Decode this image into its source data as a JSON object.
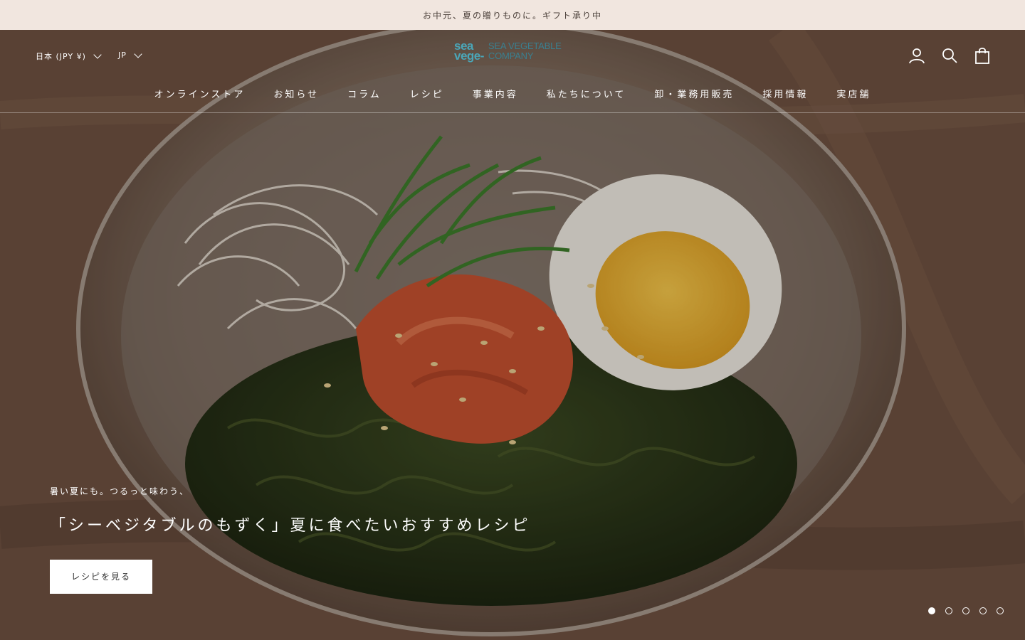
{
  "announcement": {
    "text": "お中元、夏の贈りものに。ギフト承り中"
  },
  "header": {
    "currency_label": "日本 (JPY ¥)",
    "language_label": "JP",
    "logo": {
      "mark_line1": "sea",
      "mark_line2": "vege-",
      "word_line1": "SEA VEGETABLE",
      "word_line2": "COMPANY",
      "color": "#4aa6b8"
    },
    "icons": [
      "account-icon",
      "search-icon",
      "cart-icon"
    ]
  },
  "nav": {
    "items": [
      {
        "label": "オンラインストア"
      },
      {
        "label": "お知らせ"
      },
      {
        "label": "コラム"
      },
      {
        "label": "レシピ"
      },
      {
        "label": "事業内容"
      },
      {
        "label": "私たちについて"
      },
      {
        "label": "卸・業務用販売"
      },
      {
        "label": "採用情報"
      },
      {
        "label": "実店舗"
      }
    ]
  },
  "hero": {
    "subtitle": "暑い夏にも。つるっと味わう、",
    "title": "「シーベジタブルのもずく」夏に食べたいおすすめレシピ",
    "button_label": "レシピを見る",
    "slides": {
      "count": 5,
      "active": 1
    }
  }
}
